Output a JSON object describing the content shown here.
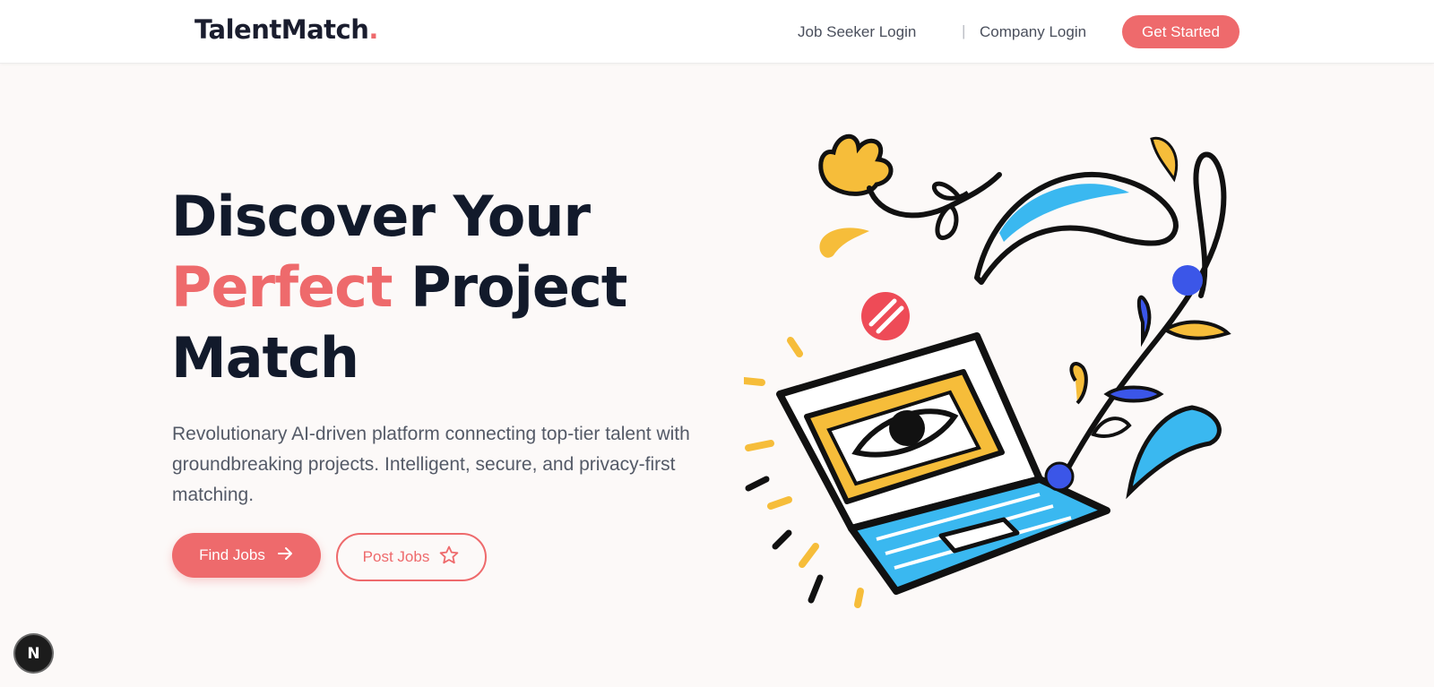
{
  "header": {
    "logo_text": "TalentMatch",
    "logo_dot": ".",
    "job_seeker_login": "Job Seeker Login",
    "separator": "|",
    "company_login": "Company Login",
    "get_started": "Get Started"
  },
  "hero": {
    "title_line1": "Discover Your",
    "title_accent": "Perfect",
    "title_line2_rest": " Project",
    "title_line3": "Match",
    "subtitle": "Revolutionary AI-driven platform connecting top-tier talent with groundbreaking projects. Intelligent, secure, and privacy-first matching.",
    "find_jobs": "Find Jobs",
    "post_jobs": "Post Jobs"
  },
  "dev_badge": "N",
  "icons": {
    "find_jobs": "arrow-right-icon",
    "post_jobs": "star-icon",
    "illustration": "laptop-eye-illustration"
  },
  "colors": {
    "accent": "#ee6a6c",
    "heading": "#121a2b",
    "yellow": "#f6bd3a",
    "cyan": "#3ab8f0",
    "blue": "#3b56e8"
  }
}
